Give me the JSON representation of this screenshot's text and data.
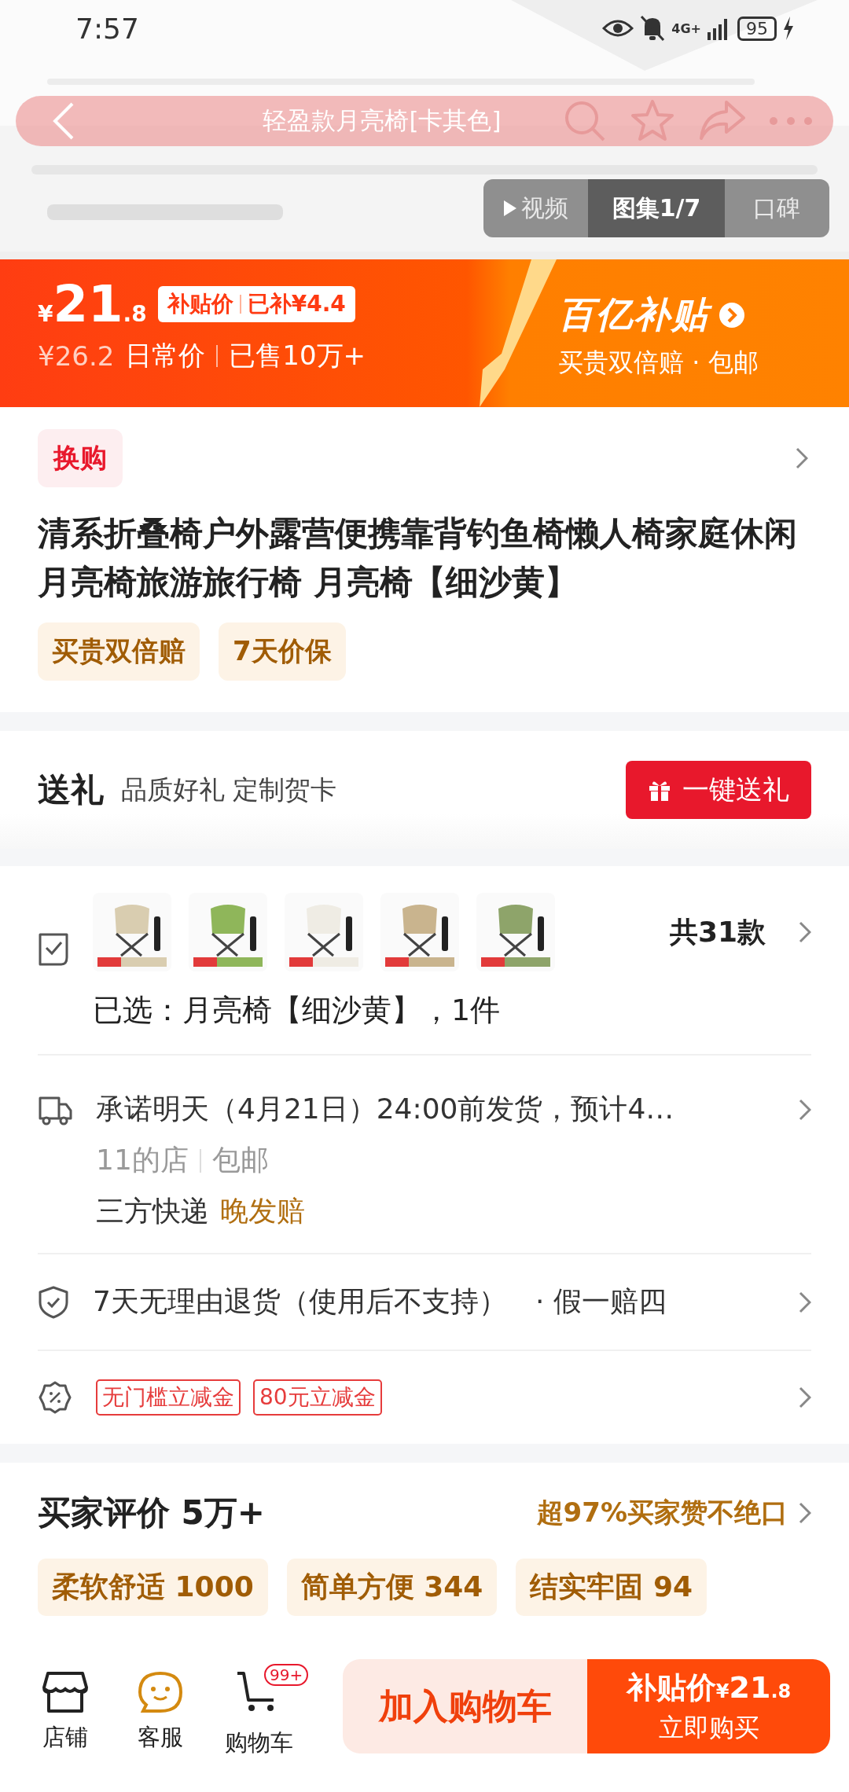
{
  "status_bar": {
    "time": "7:57",
    "network": "4G+",
    "battery": "95"
  },
  "nav": {
    "title": "轻盈款月亮椅[卡其色]"
  },
  "media_tabs": [
    {
      "label": "视频",
      "selected": false
    },
    {
      "label": "图集1/7",
      "selected": true
    },
    {
      "label": "口碑",
      "selected": false
    }
  ],
  "price_banner": {
    "currency": "¥",
    "price_int": "21",
    "price_dec": ".8",
    "subsidy_label": "补贴价",
    "subsidy_amount": "已补¥4.4",
    "original_price": "¥26.2",
    "original_label": "日常价",
    "sold": "已售10万+",
    "brand": "百亿补贴",
    "brand_sub": "买贵双倍赔 · 包邮"
  },
  "exchange_tag": "换购",
  "title": "清系折叠椅户外露营便携靠背钓鱼椅懒人椅家庭休闲月亮椅旅游旅行椅 月亮椅【细沙黄】",
  "tags": [
    "买贵双倍赔",
    "7天价保"
  ],
  "gift": {
    "title": "送礼",
    "subtitle": "品质好礼 定制贺卡",
    "button": "一键送礼"
  },
  "variants": {
    "count": "共31款",
    "selected_text": "已选：月亮椅【细沙黄】，1件"
  },
  "shipping": {
    "promise": "承诺明天（4月21日）24:00前发货，预计4…",
    "shop": "11的店",
    "fee": "包邮",
    "courier": "三方快递",
    "late_comp": "晚发赔"
  },
  "returns": {
    "text": "7天无理由退货（使用后不支持）",
    "extra": "· 假一赔四"
  },
  "coupons": [
    "无门槛立减金",
    "80元立减金"
  ],
  "reviews": {
    "title": "买家评价 5万+",
    "summary": "超97%买家赞不绝口",
    "tags": [
      "柔软舒适 1000",
      "简单方便 344",
      "结实牢固 94"
    ]
  },
  "bottom_bar": {
    "icons": [
      {
        "kind": "shop",
        "label": "店铺"
      },
      {
        "kind": "service",
        "label": "客服"
      },
      {
        "kind": "cart",
        "label": "购物车",
        "badge": "99+"
      }
    ],
    "add_to_cart": "加入购物车",
    "buy": {
      "label": "补贴价",
      "currency": "¥",
      "price_int": "21",
      "price_dec": ".8",
      "action": "立即购买"
    }
  }
}
